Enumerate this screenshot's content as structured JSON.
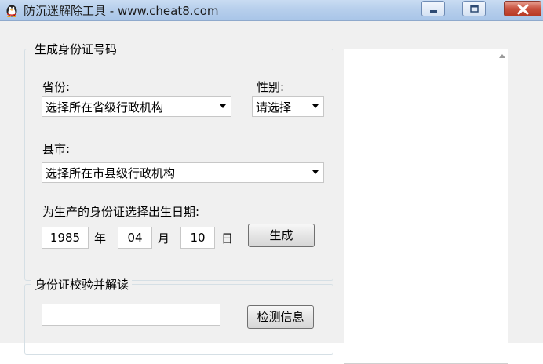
{
  "window": {
    "title": "防沉迷解除工具 - www.cheat8.com",
    "app_icon": "penguin-icon",
    "controls": [
      "minimize-icon",
      "maximize-icon",
      "close-icon"
    ]
  },
  "generate_group": {
    "legend": "生成身份证号码",
    "province_label": "省份:",
    "province_value": "选择所在省级行政机构",
    "gender_label": "性别:",
    "gender_value": "请选择",
    "county_label": "县市:",
    "county_value": "选择所在市县级行政机构",
    "birthday_label": "为生产的身份证选择出生日期:",
    "year_value": "1985",
    "year_unit": "年",
    "month_value": "04",
    "month_unit": "月",
    "day_value": "10",
    "day_unit": "日",
    "generate_button": "生成"
  },
  "verify_group": {
    "legend": "身份证校验并解读",
    "id_value": "",
    "check_button": "检测信息"
  },
  "colors": {
    "titlebar": "#b7cfec",
    "window_bg": "#f0f0f0",
    "close_button": "#c8513e"
  }
}
